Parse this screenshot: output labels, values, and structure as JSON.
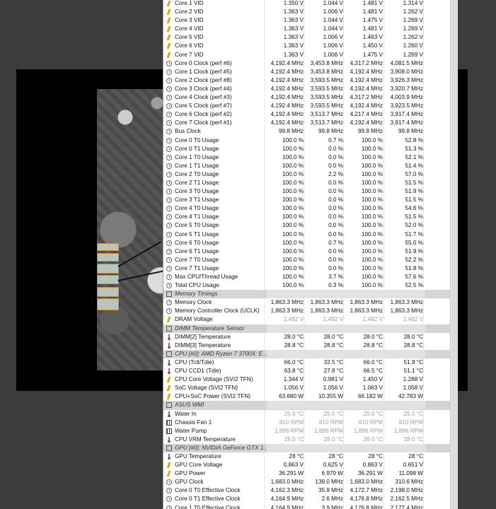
{
  "sensors": [
    {
      "icon": "volt",
      "name": "Core 1 VID",
      "values": [
        "1.350 V",
        "1.044 V",
        "1.481 V",
        "1.314 V"
      ]
    },
    {
      "icon": "volt",
      "name": "Core 2 VID",
      "values": [
        "1.363 V",
        "1.006 V",
        "1.481 V",
        "1.262 V"
      ]
    },
    {
      "icon": "volt",
      "name": "Core 3 VID",
      "values": [
        "1.363 V",
        "1.044 V",
        "1.475 V",
        "1.269 V"
      ]
    },
    {
      "icon": "volt",
      "name": "Core 4 VID",
      "values": [
        "1.363 V",
        "1.044 V",
        "1.481 V",
        "1.269 V"
      ]
    },
    {
      "icon": "volt",
      "name": "Core 5 VID",
      "values": [
        "1.363 V",
        "1.006 V",
        "1.463 V",
        "1.262 V"
      ]
    },
    {
      "icon": "volt",
      "name": "Core 6 VID",
      "values": [
        "1.363 V",
        "1.006 V",
        "1.450 V",
        "1.260 V"
      ]
    },
    {
      "icon": "volt",
      "name": "Core 7 VID",
      "values": [
        "1.363 V",
        "1.006 V",
        "1.475 V",
        "1.269 V"
      ]
    },
    {
      "icon": "clock",
      "name": "Core 0 Clock (perf #6)",
      "values": [
        "4,192.4 MHz",
        "3,453.8 MHz",
        "4,317.2 MHz",
        "4,081.5 MHz"
      ]
    },
    {
      "icon": "clock",
      "name": "Core 1 Clock (perf #5)",
      "values": [
        "4,192.4 MHz",
        "3,453.8 MHz",
        "4,192.4 MHz",
        "3,908.0 MHz"
      ]
    },
    {
      "icon": "clock",
      "name": "Core 2 Clock (perf #8)",
      "values": [
        "4,192.4 MHz",
        "3,593.5 MHz",
        "4,192.4 MHz",
        "3,926.3 MHz"
      ]
    },
    {
      "icon": "clock",
      "name": "Core 3 Clock (perf #4)",
      "values": [
        "4,192.4 MHz",
        "3,593.5 MHz",
        "4,192.4 MHz",
        "3,920.7 MHz"
      ]
    },
    {
      "icon": "clock",
      "name": "Core 4 Clock (perf #3)",
      "values": [
        "4,192.4 MHz",
        "3,593.5 MHz",
        "4,317.2 MHz",
        "4,003.9 MHz"
      ]
    },
    {
      "icon": "clock",
      "name": "Core 5 Clock (perf #7)",
      "values": [
        "4,192.4 MHz",
        "3,593.5 MHz",
        "4,192.4 MHz",
        "3,923.5 MHz"
      ]
    },
    {
      "icon": "clock",
      "name": "Core 6 Clock (perf #2)",
      "values": [
        "4,192.4 MHz",
        "3,513.7 MHz",
        "4,217.4 MHz",
        "3,917.4 MHz"
      ]
    },
    {
      "icon": "clock",
      "name": "Core 7 Clock (perf #1)",
      "values": [
        "4,192.4 MHz",
        "3,513.7 MHz",
        "4,192.4 MHz",
        "3,917.4 MHz"
      ]
    },
    {
      "icon": "clock",
      "name": "Bus Clock",
      "values": [
        "99.8 MHz",
        "99.8 MHz",
        "99.8 MHz",
        "99.8 MHz"
      ]
    },
    {
      "icon": "clock",
      "name": "Core 0 T0 Usage",
      "values": [
        "100.0 %",
        "0.7 %",
        "100.0 %",
        "52.8 %"
      ]
    },
    {
      "icon": "clock",
      "name": "Core 0 T1 Usage",
      "values": [
        "100.0 %",
        "0.0 %",
        "100.0 %",
        "51.3 %"
      ]
    },
    {
      "icon": "clock",
      "name": "Core 1 T0 Usage",
      "values": [
        "100.0 %",
        "0.0 %",
        "100.0 %",
        "52.1 %"
      ]
    },
    {
      "icon": "clock",
      "name": "Core 1 T1 Usage",
      "values": [
        "100.0 %",
        "0.0 %",
        "100.0 %",
        "51.4 %"
      ]
    },
    {
      "icon": "clock",
      "name": "Core 2 T0 Usage",
      "values": [
        "100.0 %",
        "2.2 %",
        "100.0 %",
        "57.0 %"
      ]
    },
    {
      "icon": "clock",
      "name": "Core 2 T1 Usage",
      "values": [
        "100.0 %",
        "0.0 %",
        "100.0 %",
        "51.5 %"
      ]
    },
    {
      "icon": "clock",
      "name": "Core 3 T0 Usage",
      "values": [
        "100.0 %",
        "0.0 %",
        "100.0 %",
        "51.9 %"
      ]
    },
    {
      "icon": "clock",
      "name": "Core 3 T1 Usage",
      "values": [
        "100.0 %",
        "0.0 %",
        "100.0 %",
        "51.5 %"
      ]
    },
    {
      "icon": "clock",
      "name": "Core 4 T0 Usage",
      "values": [
        "100.0 %",
        "0.0 %",
        "100.0 %",
        "54.6 %"
      ]
    },
    {
      "icon": "clock",
      "name": "Core 4 T1 Usage",
      "values": [
        "100.0 %",
        "0.0 %",
        "100.0 %",
        "51.5 %"
      ]
    },
    {
      "icon": "clock",
      "name": "Core 5 T0 Usage",
      "values": [
        "100.0 %",
        "0.0 %",
        "100.0 %",
        "52.0 %"
      ]
    },
    {
      "icon": "clock",
      "name": "Core 5 T1 Usage",
      "values": [
        "100.0 %",
        "0.0 %",
        "100.0 %",
        "51.7 %"
      ]
    },
    {
      "icon": "clock",
      "name": "Core 6 T0 Usage",
      "values": [
        "100.0 %",
        "0.7 %",
        "100.0 %",
        "55.0 %"
      ]
    },
    {
      "icon": "clock",
      "name": "Core 6 T1 Usage",
      "values": [
        "100.0 %",
        "0.0 %",
        "100.0 %",
        "51.9 %"
      ]
    },
    {
      "icon": "clock",
      "name": "Core 7 T0 Usage",
      "values": [
        "100.0 %",
        "0.0 %",
        "100.0 %",
        "52.2 %"
      ]
    },
    {
      "icon": "clock",
      "name": "Core 7 T1 Usage",
      "values": [
        "100.0 %",
        "0.0 %",
        "100.0 %",
        "51.8 %"
      ]
    },
    {
      "icon": "clock",
      "name": "Max CPU/Thread Usage",
      "values": [
        "100.0 %",
        "3.7 %",
        "100.0 %",
        "57.6 %"
      ]
    },
    {
      "icon": "clock",
      "name": "Total CPU Usage",
      "values": [
        "100.0 %",
        "0.3 %",
        "100.0 %",
        "52.5 %"
      ]
    },
    {
      "type": "header",
      "icon": "chip",
      "name": "Memory Timings"
    },
    {
      "icon": "clock",
      "name": "Memory Clock",
      "values": [
        "1,863.3 MHz",
        "1,863.3 MHz",
        "1,863.3 MHz",
        "1,863.3 MHz"
      ]
    },
    {
      "icon": "clock",
      "name": "Memory Controller Clock (UCLK)",
      "values": [
        "1,863.3 MHz",
        "1,863.3 MHz",
        "1,863.3 MHz",
        "1,863.3 MHz"
      ]
    },
    {
      "icon": "volt",
      "name": "DRAM Voltage",
      "values": [
        "1.482 V",
        "1.482 V",
        "1.482 V",
        "1.482 V"
      ],
      "disabled": true
    },
    {
      "type": "header",
      "icon": "chip",
      "name": "DIMM Temperature Sensor"
    },
    {
      "icon": "temp",
      "name": "DIMM[2] Temperature",
      "values": [
        "28.0 °C",
        "28.0 °C",
        "28.0 °C",
        "28.0 °C"
      ]
    },
    {
      "icon": "temp",
      "name": "DIMM[3] Temperature",
      "values": [
        "28.8 °C",
        "28.8 °C",
        "28.8 °C",
        "28.8 °C"
      ]
    },
    {
      "type": "header",
      "icon": "chip",
      "name": "CPU [#0]: AMD Ryzen 7 3700X: E..."
    },
    {
      "icon": "temp",
      "name": "CPU (Tctl/Tdie)",
      "values": [
        "66.0 °C",
        "32.5 °C",
        "66.0 °C",
        "51.9 °C"
      ]
    },
    {
      "icon": "temp",
      "name": "CPU CCD1 (Tdie)",
      "values": [
        "63.8 °C",
        "27.8 °C",
        "66.5 °C",
        "51.1 °C"
      ]
    },
    {
      "icon": "volt",
      "name": "CPU Core Voltage (SVI2 TFN)",
      "values": [
        "1.344 V",
        "0.981 V",
        "1.450 V",
        "1.288 V"
      ]
    },
    {
      "icon": "volt",
      "name": "SoC Voltage (SVI2 TFN)",
      "values": [
        "1.056 V",
        "1.056 V",
        "1.063 V",
        "1.058 V"
      ]
    },
    {
      "icon": "power",
      "name": "CPU+SoC Power (SVI2 TFN)",
      "values": [
        "63.680 W",
        "10.355 W",
        "66.182 W",
        "42.783 W"
      ]
    },
    {
      "type": "header",
      "icon": "chip",
      "name": "ASUS WMI"
    },
    {
      "icon": "temp",
      "name": "Water In",
      "values": [
        "25.0 °C",
        "25.0 °C",
        "25.0 °C",
        "25.0 °C"
      ],
      "disabled": true
    },
    {
      "icon": "fan",
      "name": "Chassis Fan 1",
      "values": [
        "810 RPM",
        "810 RPM",
        "810 RPM",
        "810 RPM"
      ],
      "disabled": true
    },
    {
      "icon": "fan",
      "name": "Water Pump",
      "values": [
        "1,896 RPM",
        "1,896 RPM",
        "1,896 RPM",
        "1,896 RPM"
      ],
      "disabled": true
    },
    {
      "icon": "temp",
      "name": "CPU VRM Temperature",
      "values": [
        "28.0 °C",
        "28.0 °C",
        "28.0 °C",
        "28.0 °C"
      ],
      "disabled": true
    },
    {
      "type": "header",
      "icon": "chip",
      "name": "GPU [#0]: NVIDIA GeForce GTX 1..."
    },
    {
      "icon": "temp",
      "name": "GPU Temperature",
      "values": [
        "28 °C",
        "28 °C",
        "28 °C",
        "28 °C"
      ]
    },
    {
      "icon": "volt",
      "name": "GPU Core Voltage",
      "values": [
        "0.863 V",
        "0.625 V",
        "0.863 V",
        "0.651 V"
      ]
    },
    {
      "icon": "power",
      "name": "GPU Power",
      "values": [
        "36.291 W",
        "6.970 W",
        "36.291 W",
        "11.098 W"
      ]
    },
    {
      "icon": "clock",
      "name": "GPU Clock",
      "values": [
        "1,683.0 MHz",
        "139.0 MHz",
        "1,683.0 MHz",
        "310.6 MHz"
      ]
    },
    {
      "icon": "clock",
      "name": "Core 0 T0 Effective Clock",
      "values": [
        "4,162.3 MHz",
        "35.9 MHz",
        "4,172.7 MHz",
        "2,198.0 MHz"
      ]
    },
    {
      "icon": "clock",
      "name": "Core 0 T1 Effective Clock",
      "values": [
        "4,164.9 MHz",
        "2.6 MHz",
        "4,176.8 MHz",
        "2,162.5 MHz"
      ]
    },
    {
      "icon": "clock",
      "name": "Core 1 T0 Effective Clock",
      "values": [
        "4,164.9 MHz",
        "3.9 MHz",
        "4,176.8 MHz",
        "2,177.4 MHz"
      ]
    }
  ]
}
